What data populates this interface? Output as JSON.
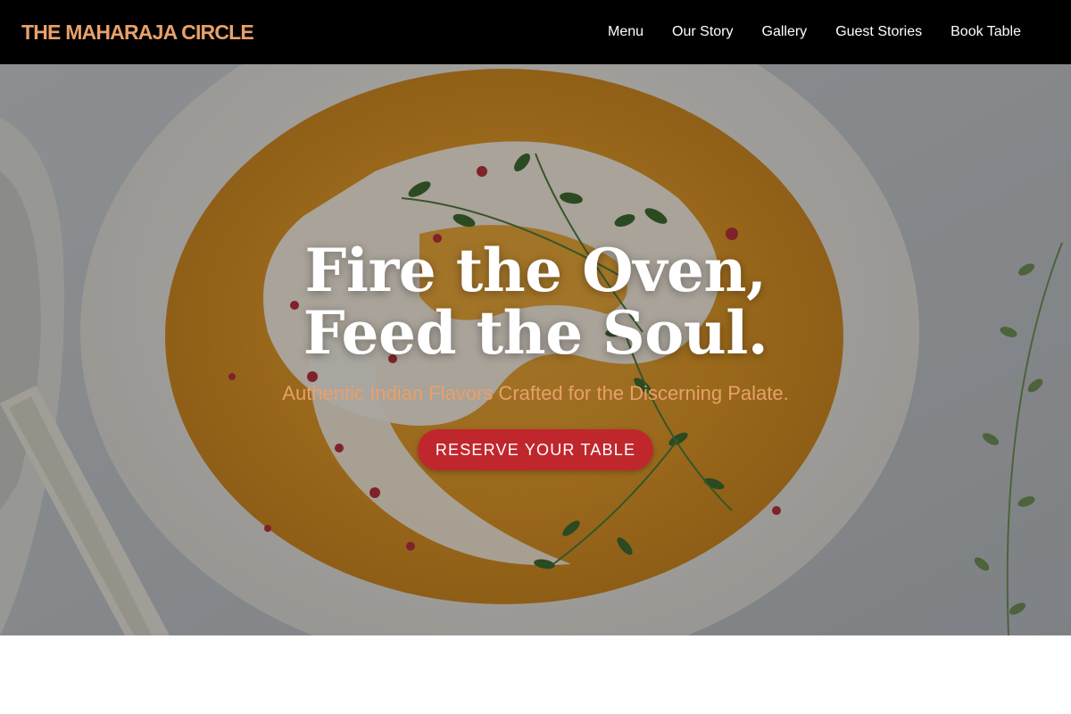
{
  "brand": {
    "name": "THE MAHARAJA CIRCLE",
    "color": "#E8A06A"
  },
  "nav": {
    "items": [
      {
        "label": "Menu"
      },
      {
        "label": "Our Story"
      },
      {
        "label": "Gallery"
      },
      {
        "label": "Guest Stories"
      },
      {
        "label": "Book Table"
      }
    ],
    "color": "#FFFFFF",
    "background": "#000000"
  },
  "hero": {
    "title_line1": "Fire the Oven,",
    "title_line2": "Feed the Soul.",
    "subtitle": "Authentic Indian Flavors Crafted for the Discerning Palate.",
    "cta_label": "RESERVE YOUR TABLE",
    "title_color": "#FFFFFF",
    "subtitle_color": "#E8A06A",
    "cta_background": "#C0272D",
    "cta_color": "#FFFFFF"
  }
}
